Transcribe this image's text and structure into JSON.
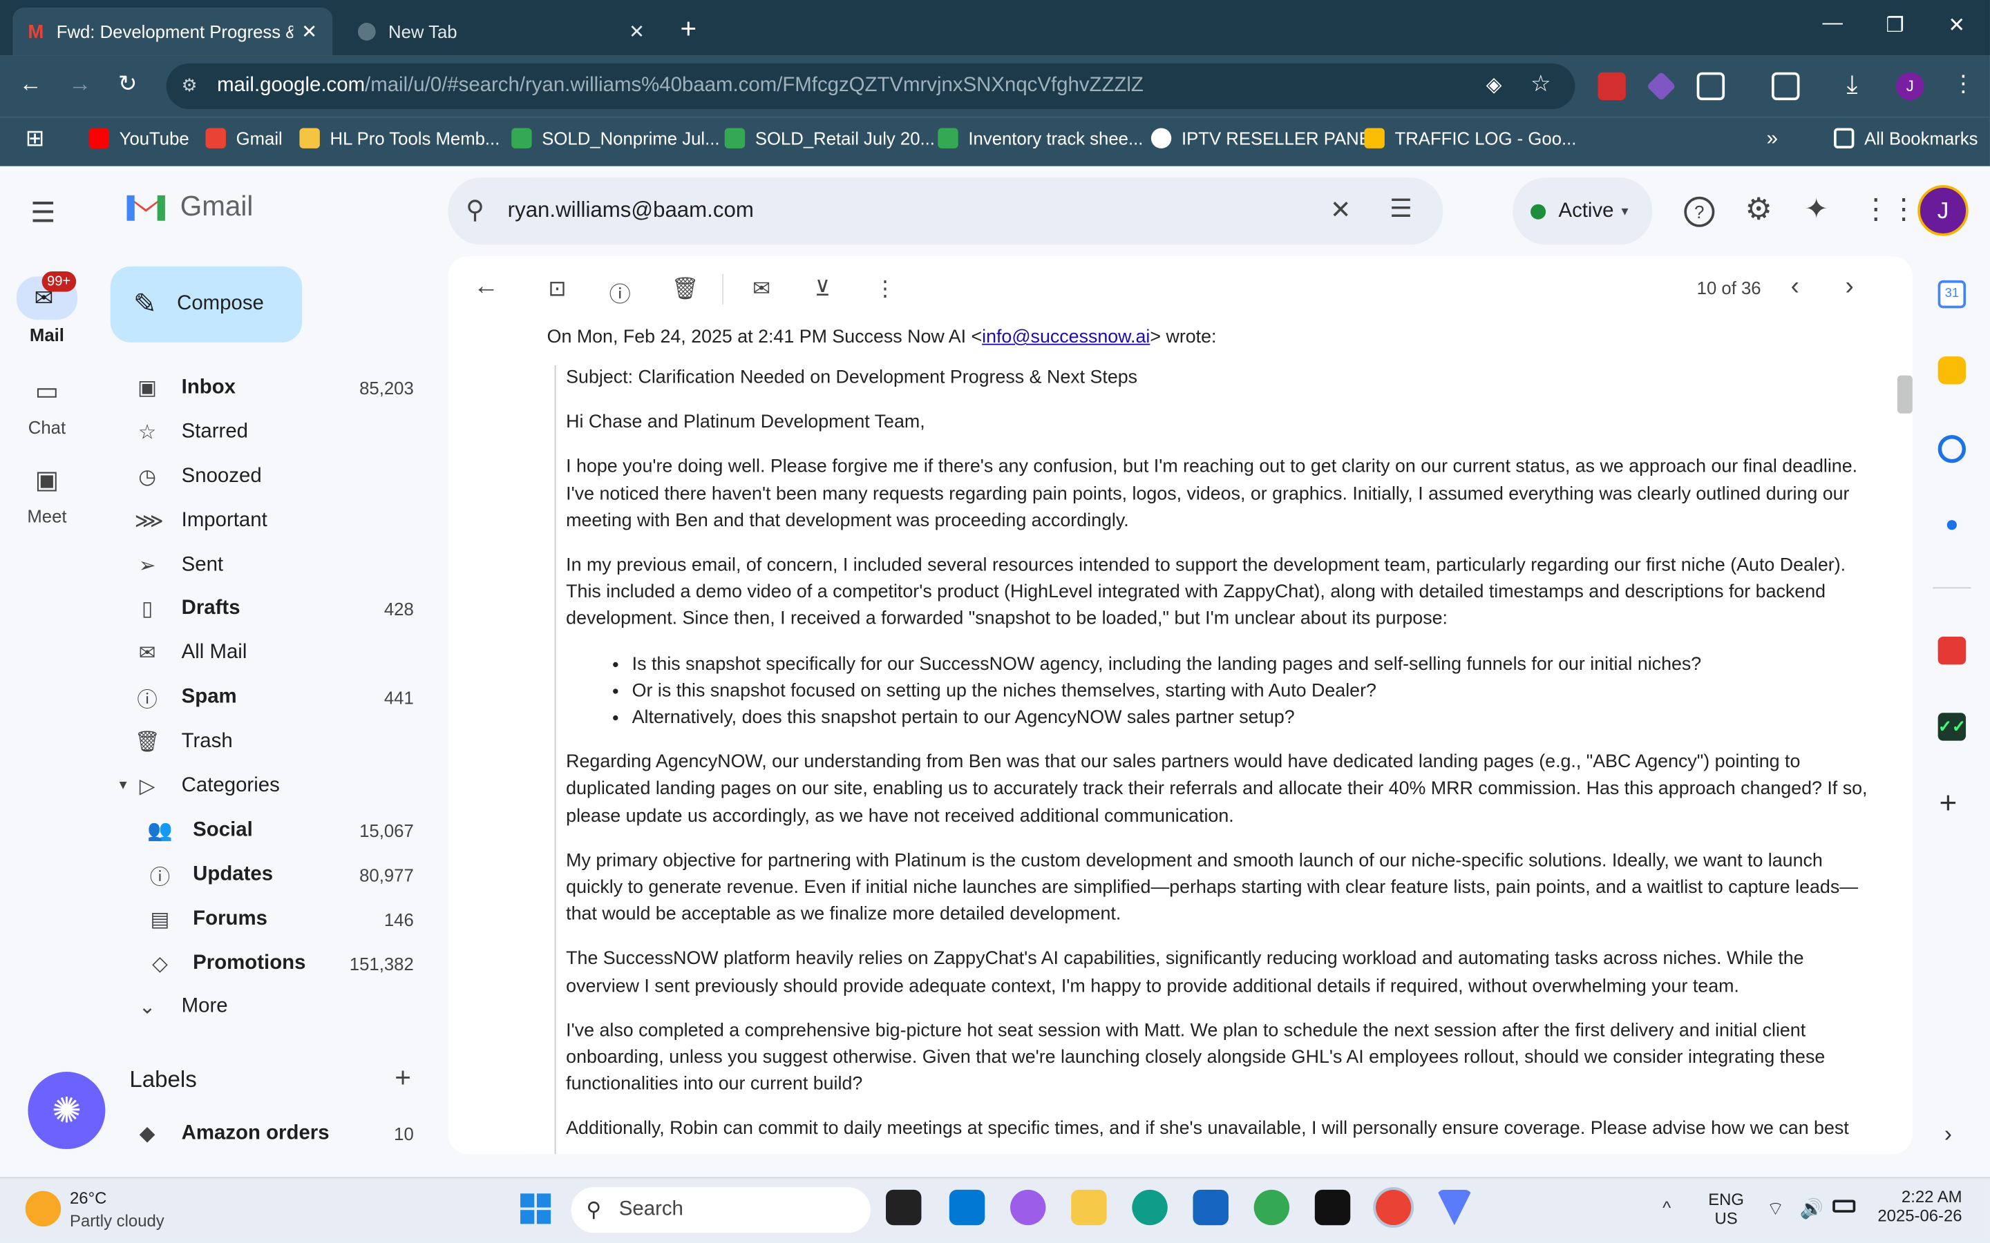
{
  "browser": {
    "tabs": [
      {
        "title": "Fwd: Development Progress & N",
        "active": true
      },
      {
        "title": "New Tab",
        "active": false
      }
    ],
    "url_host": "mail.google.com",
    "url_path": "/mail/u/0/#search/ryan.williams%40baam.com/FMfcgzQZTVmrvjnxSNXnqcVfghvZZZlZ",
    "bookmarks": [
      "YouTube",
      "Gmail",
      "HL Pro Tools Memb...",
      "SOLD_Nonprime Jul...",
      "SOLD_Retail July 20...",
      "Inventory track shee...",
      "IPTV RESELLER PANEL",
      "TRAFFIC LOG - Goo..."
    ],
    "all_bookmarks": "All Bookmarks",
    "profile_initial": "J"
  },
  "gmail": {
    "logo_text": "Gmail",
    "search_value": "ryan.williams@baam.com",
    "status": "Active",
    "avatar": "J",
    "rail": {
      "mail": "Mail",
      "mail_badge": "99+",
      "chat": "Chat",
      "meet": "Meet"
    },
    "compose": "Compose",
    "nav": [
      {
        "label": "Inbox",
        "count": "85,203",
        "bold": true,
        "icon": "inbox-icon"
      },
      {
        "label": "Starred",
        "count": "",
        "bold": false,
        "icon": "star-icon"
      },
      {
        "label": "Snoozed",
        "count": "",
        "bold": false,
        "icon": "clock-icon"
      },
      {
        "label": "Important",
        "count": "",
        "bold": false,
        "icon": "important-icon"
      },
      {
        "label": "Sent",
        "count": "",
        "bold": false,
        "icon": "send-icon"
      },
      {
        "label": "Drafts",
        "count": "428",
        "bold": true,
        "icon": "draft-icon"
      },
      {
        "label": "All Mail",
        "count": "",
        "bold": false,
        "icon": "all-mail-icon"
      },
      {
        "label": "Spam",
        "count": "441",
        "bold": true,
        "icon": "spam-icon"
      },
      {
        "label": "Trash",
        "count": "",
        "bold": false,
        "icon": "trash-icon"
      },
      {
        "label": "Categories",
        "count": "",
        "bold": false,
        "icon": "label-icon"
      }
    ],
    "categories": [
      {
        "label": "Social",
        "count": "15,067"
      },
      {
        "label": "Updates",
        "count": "80,977"
      },
      {
        "label": "Forums",
        "count": "146"
      },
      {
        "label": "Promotions",
        "count": "151,382"
      }
    ],
    "more": "More",
    "labels_title": "Labels",
    "labels": [
      {
        "label": "Amazon orders",
        "count": "10"
      }
    ],
    "pagination": "10 of 36"
  },
  "email": {
    "quote_header_pre": "On Mon, Feb 24, 2025 at 2:41 PM Success Now AI <",
    "quote_email": "info@successnow.ai",
    "quote_header_post": "> wrote:",
    "subject": "Subject: Clarification Needed on Development Progress & Next Steps",
    "greeting": "Hi Chase and Platinum Development Team,",
    "p1": "I hope you're doing well. Please forgive me if there's any confusion, but I'm reaching out to get clarity on our current status, as we approach our final deadline. I've noticed there haven't been many requests regarding pain points, logos, videos, or graphics. Initially, I assumed everything was clearly outlined during our meeting with Ben and that development was proceeding accordingly.",
    "p2": "In my previous email, of concern, I included several resources intended to support the development team, particularly regarding our first niche (Auto Dealer). This included a demo video of a competitor's product (HighLevel integrated with ZappyChat), along with detailed timestamps and descriptions for backend development. Since then, I received a forwarded \"snapshot to be loaded,\" but I'm unclear about its purpose:",
    "bullets": [
      "Is this snapshot specifically for our SuccessNOW agency, including the landing pages and self-selling funnels for our initial niches?",
      "Or is this snapshot focused on setting up the niches themselves, starting with Auto Dealer?",
      "Alternatively, does this snapshot pertain to our AgencyNOW sales partner setup?"
    ],
    "p3": "Regarding AgencyNOW, our understanding from Ben was that our sales partners would have dedicated landing pages (e.g., \"ABC Agency\") pointing to duplicated landing pages on our site, enabling us to accurately track their referrals and allocate their 40% MRR commission. Has this approach changed? If so, please update us accordingly, as we have not received additional communication.",
    "p4": "My primary objective for partnering with Platinum is the custom development and smooth launch of our niche-specific solutions. Ideally, we want to launch quickly to generate revenue. Even if initial niche launches are simplified—perhaps starting with clear feature lists, pain points, and a waitlist to capture leads—that would be acceptable as we finalize more detailed development.",
    "p5": "The SuccessNOW platform heavily relies on ZappyChat's AI capabilities, significantly reducing workload and automating tasks across niches. While the overview I sent previously should provide adequate context, I'm happy to provide additional details if required, without overwhelming your team.",
    "p6": "I've also completed a comprehensive big-picture hot seat session with Matt. We plan to schedule the next session after the first delivery and initial client onboarding, unless you suggest otherwise. Given that we're launching closely alongside GHL's AI employees rollout, should we consider integrating these functionalities into our current build?",
    "p7": "Additionally, Robin can commit to daily meetings at specific times, and if she's unavailable, I will personally ensure coverage. Please advise how we can best"
  },
  "taskbar": {
    "weather_temp": "26°C",
    "weather_desc": "Partly cloudy",
    "search": "Search",
    "lang1": "ENG",
    "lang2": "US",
    "time": "2:22 AM",
    "date": "2025-06-26"
  },
  "colors": {
    "chrome_dark": "#1d3a4a",
    "chrome": "#2f5062",
    "compose": "#c2e7ff",
    "link": "#1a0dab",
    "avatar": "#6a1b9a"
  }
}
